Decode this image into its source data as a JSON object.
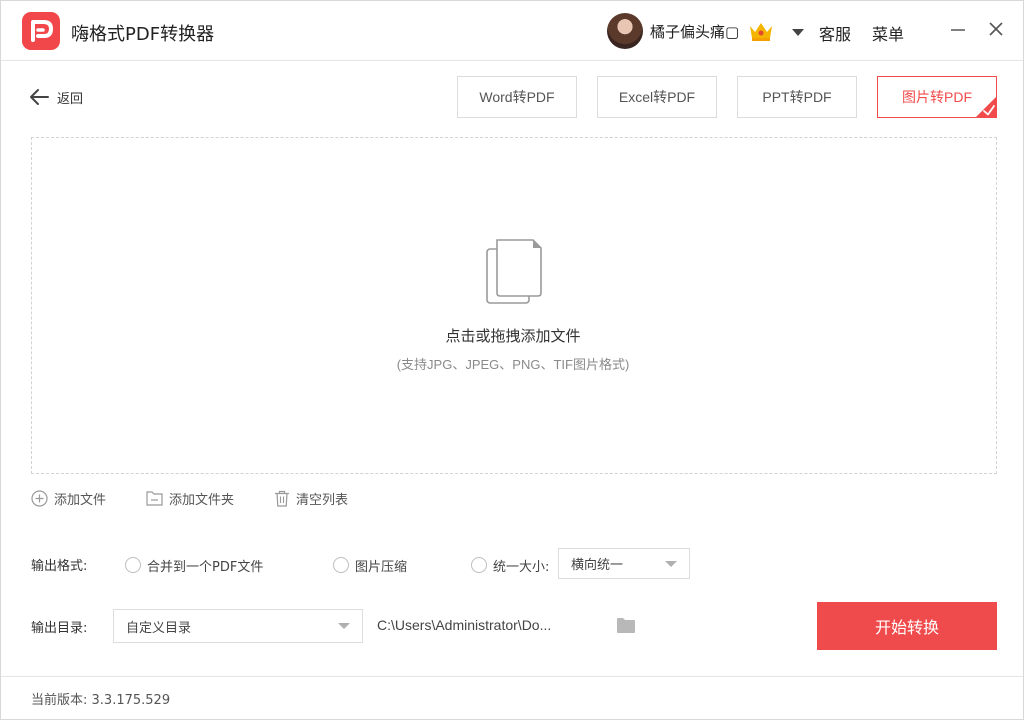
{
  "app": {
    "title": "嗨格式PDF转换器"
  },
  "user": {
    "name": "橘子偏头痛",
    "status_glyph": "▢"
  },
  "header": {
    "service_label": "客服",
    "menu_label": "菜单"
  },
  "nav": {
    "back_label": "返回"
  },
  "tabs": [
    {
      "label": "Word转PDF",
      "active": false
    },
    {
      "label": "Excel转PDF",
      "active": false
    },
    {
      "label": "PPT转PDF",
      "active": false
    },
    {
      "label": "图片转PDF",
      "active": true
    }
  ],
  "dropzone": {
    "title": "点击或拖拽添加文件",
    "subtitle": "(支持JPG、JPEG、PNG、TIF图片格式)"
  },
  "file_actions": {
    "add_file": "添加文件",
    "add_folder": "添加文件夹",
    "clear_list": "清空列表"
  },
  "output_format": {
    "label": "输出格式:",
    "option_merge": "合并到一个PDF文件",
    "option_compress": "图片压缩",
    "option_uniform": "统一大小:",
    "uniform_select_value": "横向统一"
  },
  "output_dir": {
    "label": "输出目录:",
    "select_value": "自定义目录",
    "path": "C:\\Users\\Administrator\\Do..."
  },
  "actions": {
    "start_label": "开始转换"
  },
  "footer": {
    "version_label": "当前版本:",
    "version_value": "3.3.175.529"
  },
  "colors": {
    "accent": "#f04b4c",
    "border": "#dcdcdc",
    "crown": "#f5b400"
  }
}
